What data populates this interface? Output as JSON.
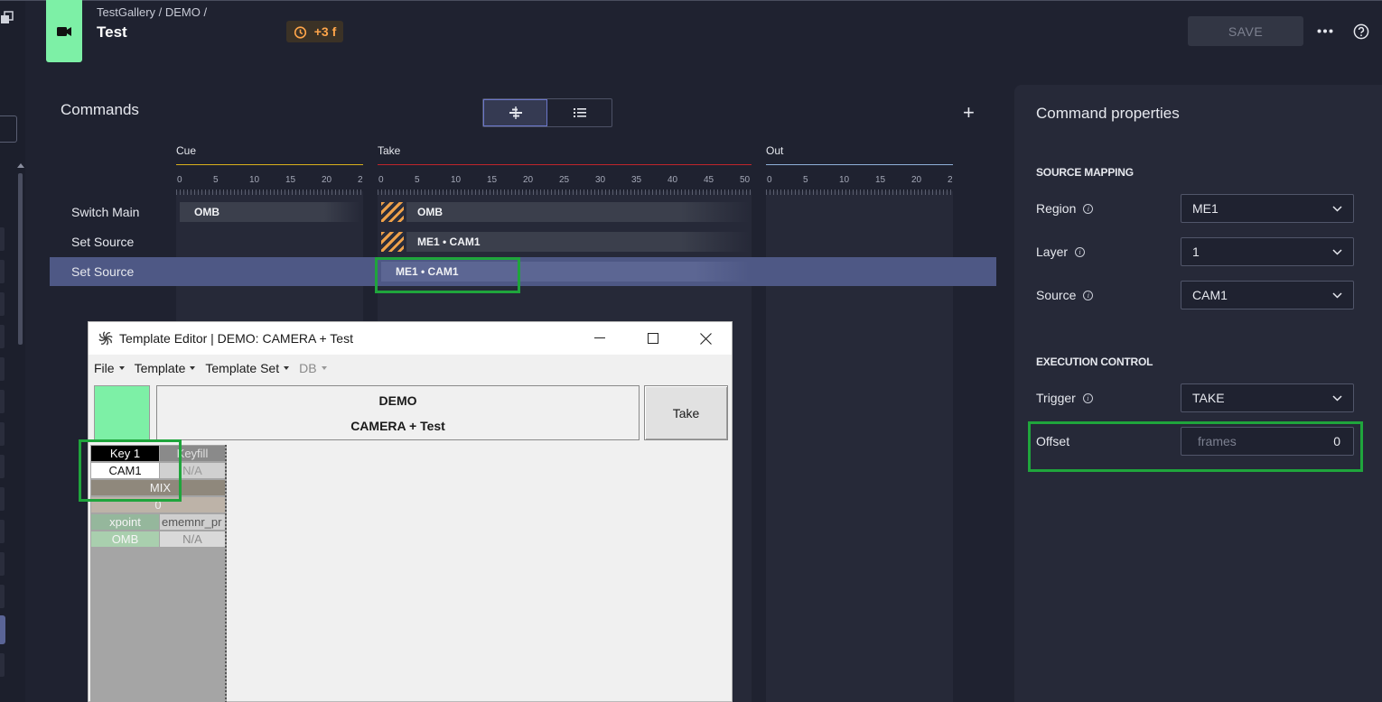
{
  "header": {
    "breadcrumb": "TestGallery / DEMO /",
    "title": "Test",
    "offset_badge": "+3 f",
    "save_label": "SAVE",
    "accent_color": "#7df0a6",
    "badge_color": "#ffa54a"
  },
  "commands": {
    "title": "Commands",
    "add_label": "+",
    "phases": [
      {
        "name": "Cue",
        "color": "#d8b01c",
        "ticks": [
          "0",
          "5",
          "10",
          "15",
          "20",
          "2"
        ]
      },
      {
        "name": "Take",
        "color": "#c0252b",
        "ticks": [
          "0",
          "5",
          "10",
          "15",
          "20",
          "25",
          "30",
          "35",
          "40",
          "45",
          "50"
        ]
      },
      {
        "name": "Out",
        "color": "#8fb0d8",
        "ticks": [
          "0",
          "5",
          "10",
          "15",
          "20",
          "2"
        ]
      }
    ],
    "rows": [
      {
        "label": "Switch Main",
        "cue_bar": "OMB",
        "take_bar": "OMB"
      },
      {
        "label": "Set Source",
        "take_bar": "ME1 • CAM1"
      },
      {
        "label": "Set Source",
        "take_bar": "ME1 • CAM1"
      }
    ]
  },
  "properties": {
    "title": "Command properties",
    "source_mapping": {
      "heading": "SOURCE MAPPING",
      "region": {
        "label": "Region",
        "value": "ME1"
      },
      "layer": {
        "label": "Layer",
        "value": "1"
      },
      "source": {
        "label": "Source",
        "value": "CAM1"
      }
    },
    "execution_control": {
      "heading": "EXECUTION CONTROL",
      "trigger": {
        "label": "Trigger",
        "value": "TAKE"
      },
      "offset": {
        "label": "Offset",
        "placeholder": "frames",
        "value": "0"
      }
    }
  },
  "template_editor": {
    "title": "Template Editor | DEMO: CAMERA + Test",
    "menu": [
      "File",
      "Template",
      "Template Set",
      "DB"
    ],
    "box_line1": "DEMO",
    "box_line2": "CAMERA + Test",
    "take_label": "Take",
    "grid": {
      "key1": "Key 1",
      "keyfill": "Keyfill",
      "cam1": "CAM1",
      "na1": "N/A",
      "mix": "MIX",
      "zero": "0",
      "xpoint": "xpoint",
      "ememnr": "ememnr_pr",
      "omb": "OMB",
      "na2": "N/A"
    }
  }
}
